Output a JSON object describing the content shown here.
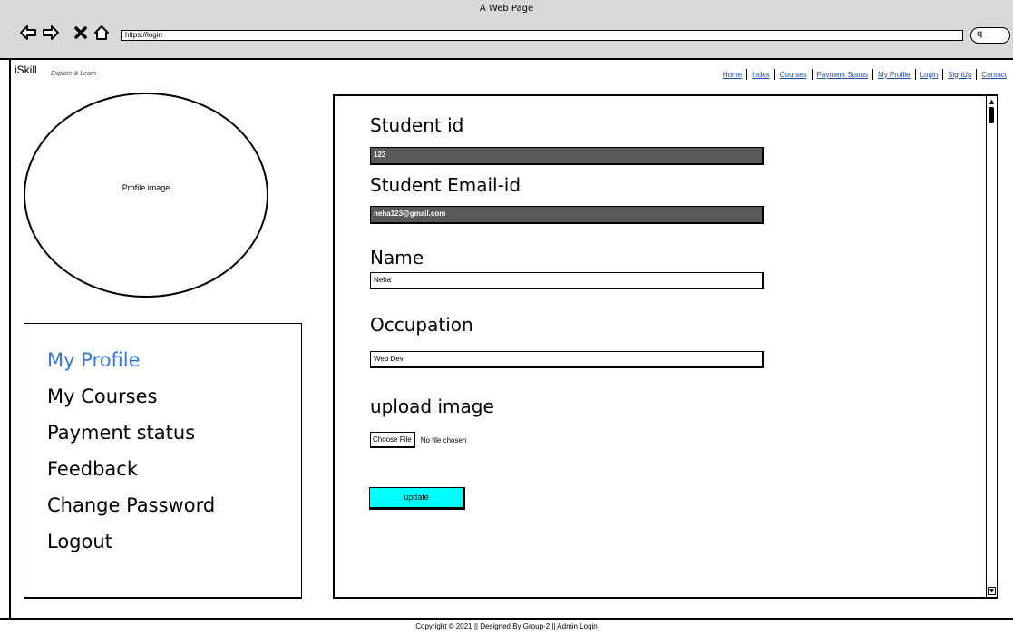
{
  "browser": {
    "title": "A Web Page",
    "url": "https://login",
    "search_glyph": "q"
  },
  "site": {
    "logo": "iSkill",
    "tagline": "Explore & Learn"
  },
  "nav": {
    "items": [
      "Home",
      "Index",
      "Courses",
      "Payment Status",
      "My Profile",
      "Login",
      "SignUp",
      "Contact"
    ]
  },
  "profile": {
    "image_label": "Profile image"
  },
  "sidebar": {
    "items": [
      {
        "label": "My Profile",
        "active": true
      },
      {
        "label": "My Courses",
        "active": false
      },
      {
        "label": "Payment status",
        "active": false
      },
      {
        "label": "Feedback",
        "active": false
      },
      {
        "label": "Change Password",
        "active": false
      },
      {
        "label": "Logout",
        "active": false
      }
    ]
  },
  "form": {
    "student_id_label": "Student id",
    "student_id_value": "123",
    "email_label": "Student Email-id",
    "email_value": "neha123@gmail.com",
    "name_label": "Name",
    "name_value": "Neha",
    "occupation_label": "Occupation",
    "occupation_value": "Web Dev",
    "upload_label": "upload image",
    "choose_file_label": "Choose File",
    "file_status": "No file chosen",
    "update_label": "update"
  },
  "footer": {
    "text": "Copyright © 2021 || Designed By Group-2 || Admin Login"
  },
  "colors": {
    "active_menu": "#3a78d8",
    "update_button": "#00ffff",
    "readonly_field": "#595959",
    "link": "#1a4fa8"
  }
}
